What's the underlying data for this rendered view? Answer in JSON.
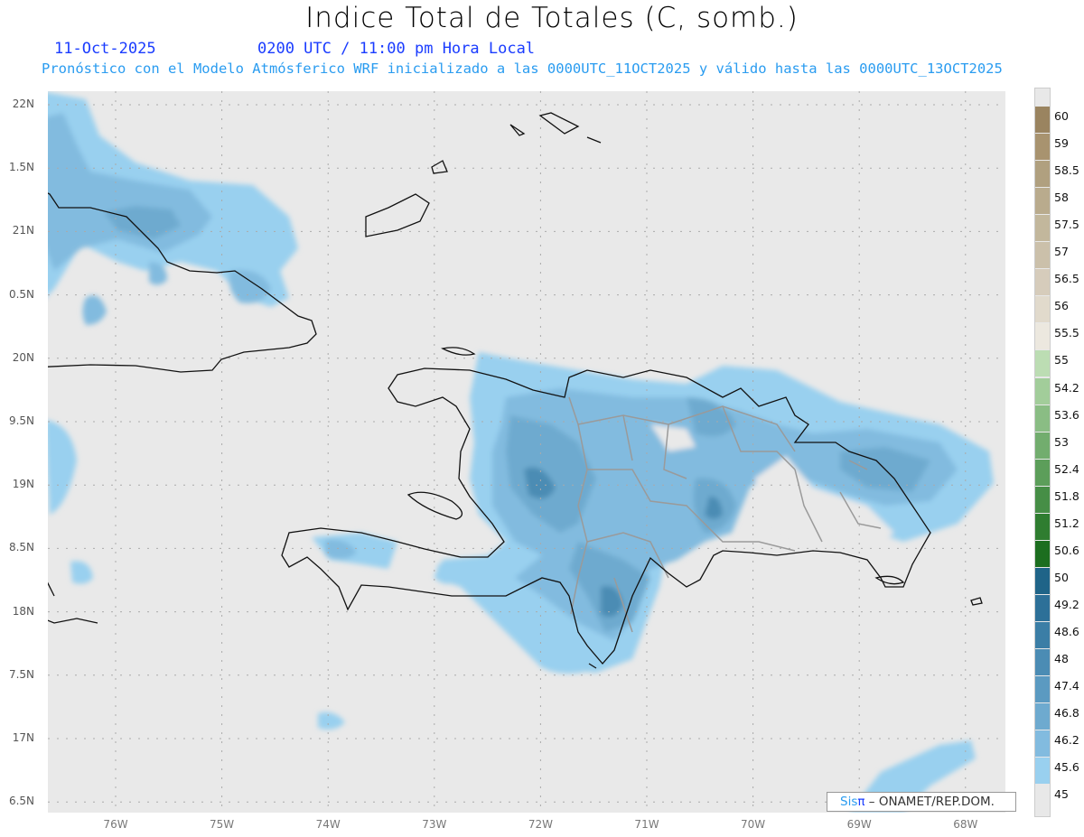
{
  "header": {
    "title": "Indice Total de Totales (C, somb.)",
    "date": "11-Oct-2025",
    "time": "0200 UTC / 11:00 pm Hora Local",
    "description": "Pronóstico con el Modelo Atmósferico WRF inicializado a las 0000UTC_11OCT2025 y válido hasta las  0000UTC_13OCT2025"
  },
  "axes": {
    "lat_labels": [
      "22N",
      "1.5N",
      "21N",
      "0.5N",
      "20N",
      "9.5N",
      "19N",
      "8.5N",
      "18N",
      "7.5N",
      "17N",
      "6.5N"
    ],
    "lon_labels": [
      "76W",
      "75W",
      "74W",
      "73W",
      "72W",
      "71W",
      "70W",
      "69W",
      "68W"
    ]
  },
  "colorbar": {
    "labels": [
      "60",
      "59",
      "58.5",
      "58",
      "57.5",
      "57",
      "56.5",
      "56",
      "55.5",
      "55",
      "54.2",
      "53.6",
      "53",
      "52.4",
      "51.8",
      "51.2",
      "50.6",
      "50",
      "49.2",
      "48.6",
      "48",
      "47.4",
      "46.8",
      "46.2",
      "45.6",
      "45"
    ],
    "colors": [
      "#9a8460",
      "#a8936f",
      "#b0a07f",
      "#b9ab8d",
      "#c2b79c",
      "#cbc0aa",
      "#d6ccbb",
      "#e1dacc",
      "#ece8df",
      "#bcddb3",
      "#a2cd9a",
      "#8abd84",
      "#72ad6e",
      "#5c9e5a",
      "#468e46",
      "#2f7d30",
      "#1c6e1f",
      "#1f6488",
      "#2d7098",
      "#3b7ea6",
      "#4b8cb4",
      "#5b9ac1",
      "#6eaacf",
      "#82bbdf",
      "#99d0ef"
    ]
  },
  "credit": {
    "sis": "Sis",
    "pi": "π",
    "org": "– ONAMET/REP.DOM."
  }
}
